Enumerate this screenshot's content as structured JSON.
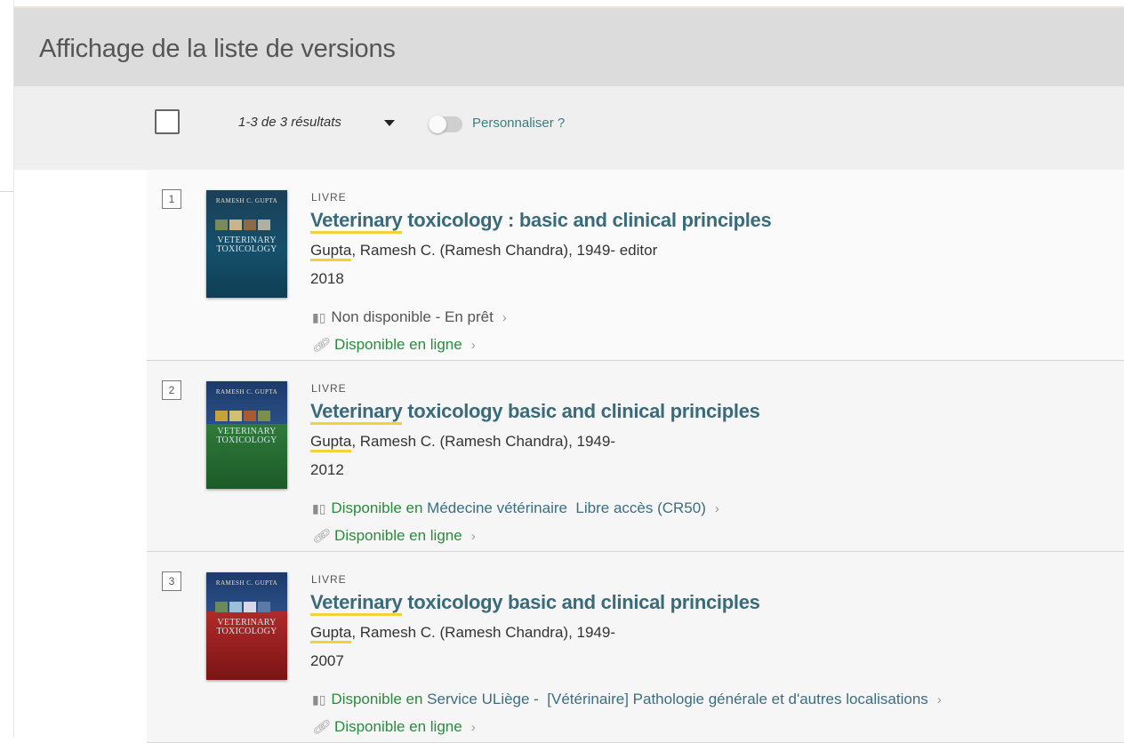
{
  "page": {
    "title": "Affichage de la liste de versions"
  },
  "toolbar": {
    "results_count": "1-3 de 3 résultats",
    "personalize_label": "Personnaliser ?"
  },
  "colors": {
    "title_link": "#3a6b7b",
    "available_green": "#2a8a3e",
    "highlight": "#f3d239"
  },
  "results": [
    {
      "number": "1",
      "type": "LIVRE",
      "title_highlight": "Veterinary",
      "title_rest": " toxicology : basic and clinical principles",
      "author_highlight": "Gupta",
      "author_rest": ", Ramesh C. (Ramesh Chandra), 1949- editor",
      "year": "2018",
      "availability": {
        "status": "Non disponible - En prêt",
        "location": "",
        "status_color": "grey"
      },
      "online": "Disponible en ligne",
      "cover": {
        "author": "RAMESH C. GUPTA",
        "title_line1": "VETERINARY",
        "title_line2": "TOXICOLOGY"
      }
    },
    {
      "number": "2",
      "type": "LIVRE",
      "title_highlight": "Veterinary",
      "title_rest": " toxicology basic and clinical principles",
      "author_highlight": "Gupta",
      "author_rest": ", Ramesh C. (Ramesh Chandra), 1949-",
      "year": "2012",
      "availability": {
        "status": "Disponible en",
        "location": "Médecine vétérinaire  Libre accès (CR50)",
        "status_color": "green"
      },
      "online": "Disponible en ligne",
      "cover": {
        "author": "RAMESH C. GUPTA",
        "title_line1": "VETERINARY",
        "title_line2": "TOXICOLOGY"
      }
    },
    {
      "number": "3",
      "type": "LIVRE",
      "title_highlight": "Veterinary",
      "title_rest": " toxicology basic and clinical principles",
      "author_highlight": "Gupta",
      "author_rest": ", Ramesh C. (Ramesh Chandra), 1949-",
      "year": "2007",
      "availability": {
        "status": "Disponible en",
        "location": "Service ULiège -  [Vétérinaire] Pathologie générale et d'autres localisations",
        "status_color": "green"
      },
      "online": "Disponible en ligne",
      "cover": {
        "author": "RAMESH C. GUPTA",
        "title_line1": "VETERINARY",
        "title_line2": "TOXICOLOGY"
      }
    }
  ]
}
